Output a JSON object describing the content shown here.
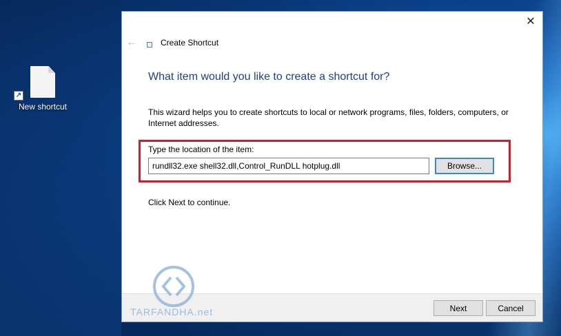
{
  "desktop": {
    "icon_label": "New shortcut"
  },
  "dialog": {
    "title": "Create Shortcut",
    "close_glyph": "✕",
    "back_glyph": "←",
    "heading": "What item would you like to create a shortcut for?",
    "description": "This wizard helps you to create shortcuts to local or network programs, files, folders, computers, or Internet addresses.",
    "location_label": "Type the location of the item:",
    "location_value": "rundll32.exe shell32.dll,Control_RunDLL hotplug.dll",
    "browse_label": "Browse...",
    "next_hint": "Click Next to continue.",
    "next_label": "Next",
    "cancel_label": "Cancel"
  },
  "watermark": {
    "text": "TARFANDHA.net"
  },
  "colors": {
    "heading": "#1e3f8a",
    "highlight": "#d51b2a",
    "focus": "#3a86d6"
  }
}
